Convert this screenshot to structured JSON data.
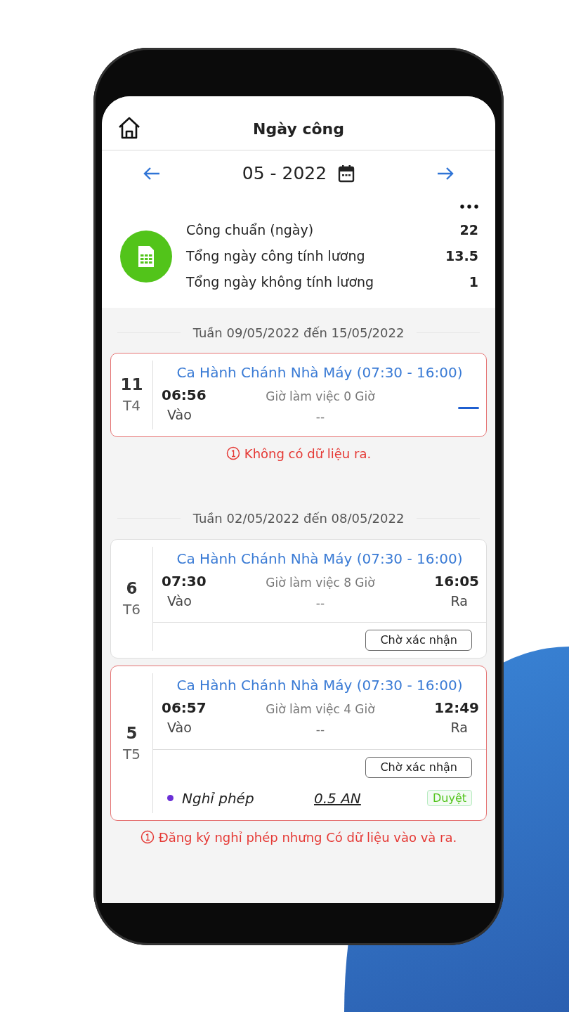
{
  "header": {
    "title": "Ngày công"
  },
  "period": {
    "label": "05 - 2022"
  },
  "summary": [
    {
      "label": "Công chuẩn (ngày)",
      "value": "22"
    },
    {
      "label": "Tổng ngày công tính lương",
      "value": "13.5"
    },
    {
      "label": "Tổng ngày không tính lương",
      "value": "1"
    }
  ],
  "weeks": [
    {
      "label": "Tuần 09/05/2022 đến 15/05/2022",
      "days": [
        {
          "day": "11",
          "weekday": "T4",
          "alert": true,
          "shift": "Ca Hành Chánh Nhà Máy (07:30 - 16:00)",
          "in_time": "06:56",
          "in_label": "Vào",
          "work_hours": "Giờ làm việc 0 Giờ",
          "note": "--",
          "warning": "Không có dữ liệu ra."
        }
      ]
    },
    {
      "label": "Tuần 02/05/2022 đến 08/05/2022",
      "days": [
        {
          "day": "6",
          "weekday": "T6",
          "alert": false,
          "shift": "Ca Hành Chánh Nhà Máy (07:30 - 16:00)",
          "in_time": "07:30",
          "in_label": "Vào",
          "work_hours": "Giờ làm việc 8 Giờ",
          "note": "--",
          "out_time": "16:05",
          "out_label": "Ra",
          "status_button": "Chờ xác nhận"
        },
        {
          "day": "5",
          "weekday": "T5",
          "alert": true,
          "shift": "Ca Hành Chánh Nhà Máy (07:30 - 16:00)",
          "in_time": "06:57",
          "in_label": "Vào",
          "work_hours": "Giờ làm việc 4 Giờ",
          "note": "--",
          "out_time": "12:49",
          "out_label": "Ra",
          "status_button": "Chờ xác nhận",
          "leave": {
            "label": "Nghỉ phép",
            "amount": "0.5 AN",
            "status": "Duyệt",
            "color": "#6a2fd6"
          },
          "warning": "Đăng ký nghỉ phép nhưng Có dữ liệu vào và ra."
        }
      ]
    }
  ]
}
